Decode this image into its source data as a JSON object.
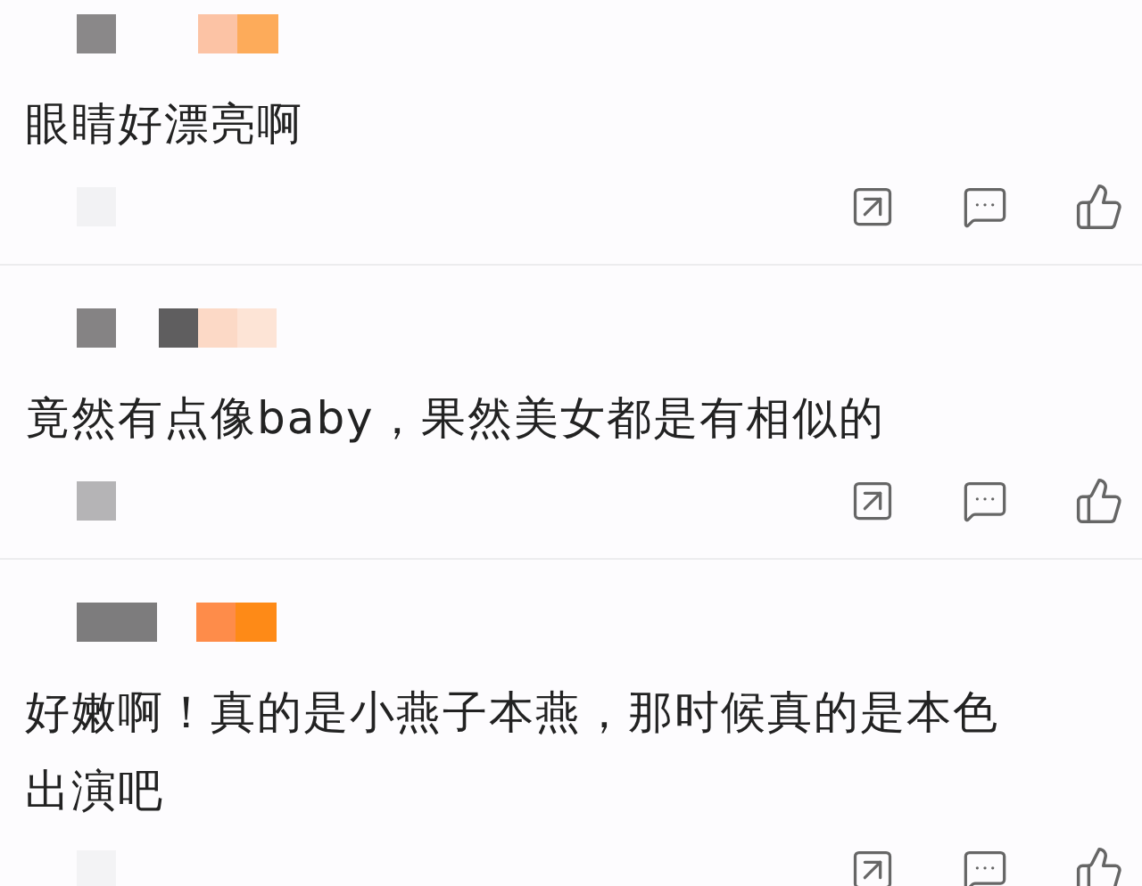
{
  "comments": [
    {
      "text": "眼睛好漂亮啊"
    },
    {
      "text": "竟然有点像baby，果然美女都是有相似的"
    },
    {
      "text": "好嫩啊！真的是小燕子本燕，那时候真的是本色出演吧"
    }
  ]
}
